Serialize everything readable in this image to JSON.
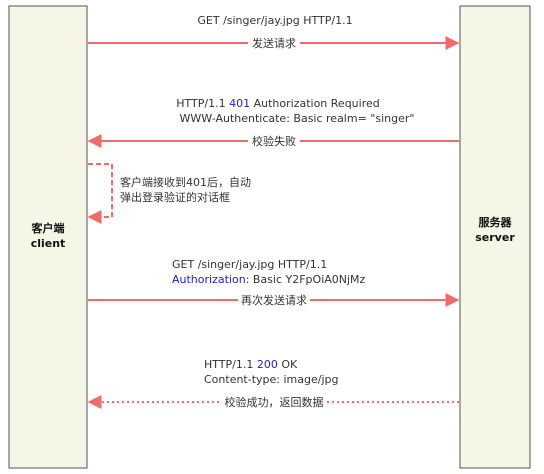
{
  "client": {
    "label_cn": "客户端",
    "label_en": "client"
  },
  "server": {
    "label_cn": "服务器",
    "label_en": "server"
  },
  "messages": [
    {
      "header_lines": [
        {
          "parts": [
            {
              "text": "GET /singer/jay.jpg HTTP/1.1"
            }
          ]
        }
      ],
      "arrow_label": "发送请求",
      "direction": "to-server",
      "style": "solid"
    },
    {
      "header_lines": [
        {
          "parts": [
            {
              "text": "HTTP/1.1 "
            },
            {
              "text": "401",
              "highlight": true
            },
            {
              "text": " Authorization Required"
            }
          ]
        },
        {
          "parts": [
            {
              "text": "WWW-Authenticate: Basic realm= \"singer\""
            }
          ]
        }
      ],
      "arrow_label": "校验失败",
      "direction": "to-client",
      "style": "solid"
    },
    {
      "header_lines": [
        {
          "parts": [
            {
              "text": "GET /singer/jay.jpg HTTP/1.1"
            }
          ]
        },
        {
          "parts": [
            {
              "text": "Authorization",
              "highlight": true
            },
            {
              "text": ": Basic Y2FpOiA0NjMz"
            }
          ]
        }
      ],
      "arrow_label": "再次发送请求",
      "direction": "to-server",
      "style": "solid"
    },
    {
      "header_lines": [
        {
          "parts": [
            {
              "text": "HTTP/1.1 "
            },
            {
              "text": "200",
              "highlight": true
            },
            {
              "text": " OK"
            }
          ]
        },
        {
          "parts": [
            {
              "text": "Content-type: image/jpg"
            }
          ]
        }
      ],
      "arrow_label": "校验成功，返回数据",
      "direction": "to-client",
      "style": "dotted"
    }
  ],
  "self_loop": {
    "lines": [
      "客户端接收到401后，自动",
      "弹出登录验证的对话框"
    ]
  },
  "colors": {
    "arrow": "#f26b6b",
    "highlight": "#1e1ecc",
    "box_fill": "#f5f6e6",
    "box_stroke": "#555555"
  }
}
